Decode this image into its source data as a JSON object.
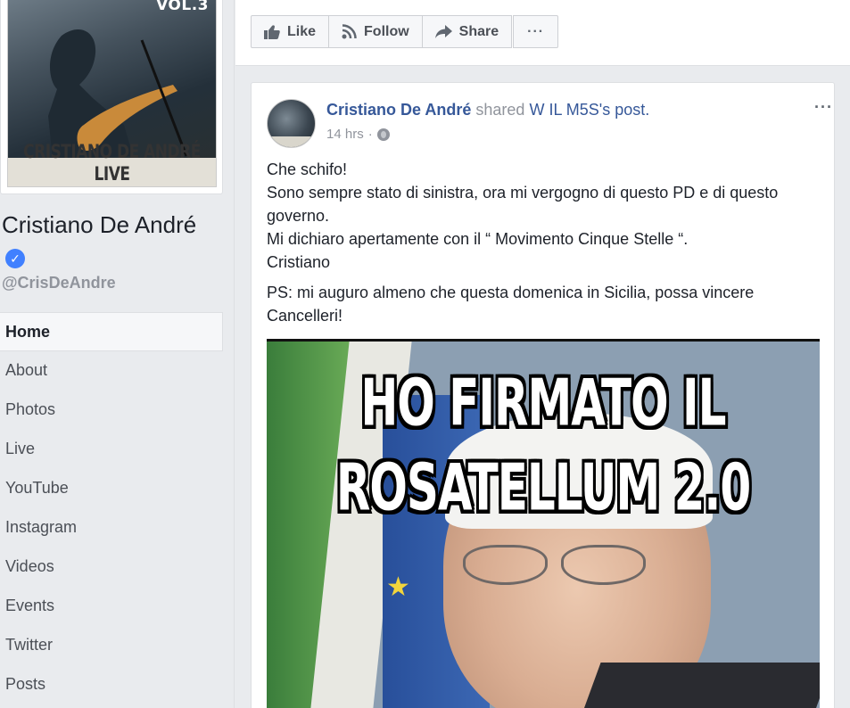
{
  "page": {
    "name": "Cristiano De André",
    "username": "@CrisDeAndre",
    "verified_badge": "✓",
    "cover": {
      "header_text": "VOL.3",
      "title_text": "CRISTIANO DE ANDRÉ LIVE"
    }
  },
  "nav": {
    "items": [
      "Home",
      "About",
      "Photos",
      "Live",
      "YouTube",
      "Instagram",
      "Videos",
      "Events",
      "Twitter",
      "Posts"
    ],
    "active": "Home"
  },
  "actions": {
    "like": "Like",
    "follow": "Follow",
    "share": "Share",
    "more": "···"
  },
  "post": {
    "author": "Cristiano De André",
    "shared_text": "shared",
    "shared_source": "W IL M5S's post.",
    "time": "14 hrs",
    "separator": "·",
    "menu": "···",
    "paragraph1_lines": [
      "Che schifo!",
      "Sono sempre stato di sinistra, ora mi vergogno di questo PD e di questo governo.",
      "Mi dichiaro apertamente con il “ Movimento Cinque Stelle “.",
      "Cristiano"
    ],
    "paragraph2": "PS: mi auguro almeno che questa domenica in Sicilia, possa vincere Cancelleri!",
    "image": {
      "line1": "HO FIRMATO IL",
      "line2": "ROSATELLUM 2.0"
    }
  },
  "colors": {
    "link": "#365899",
    "muted": "#90949c",
    "background": "#e9ebee",
    "verified": "#4080ff"
  }
}
